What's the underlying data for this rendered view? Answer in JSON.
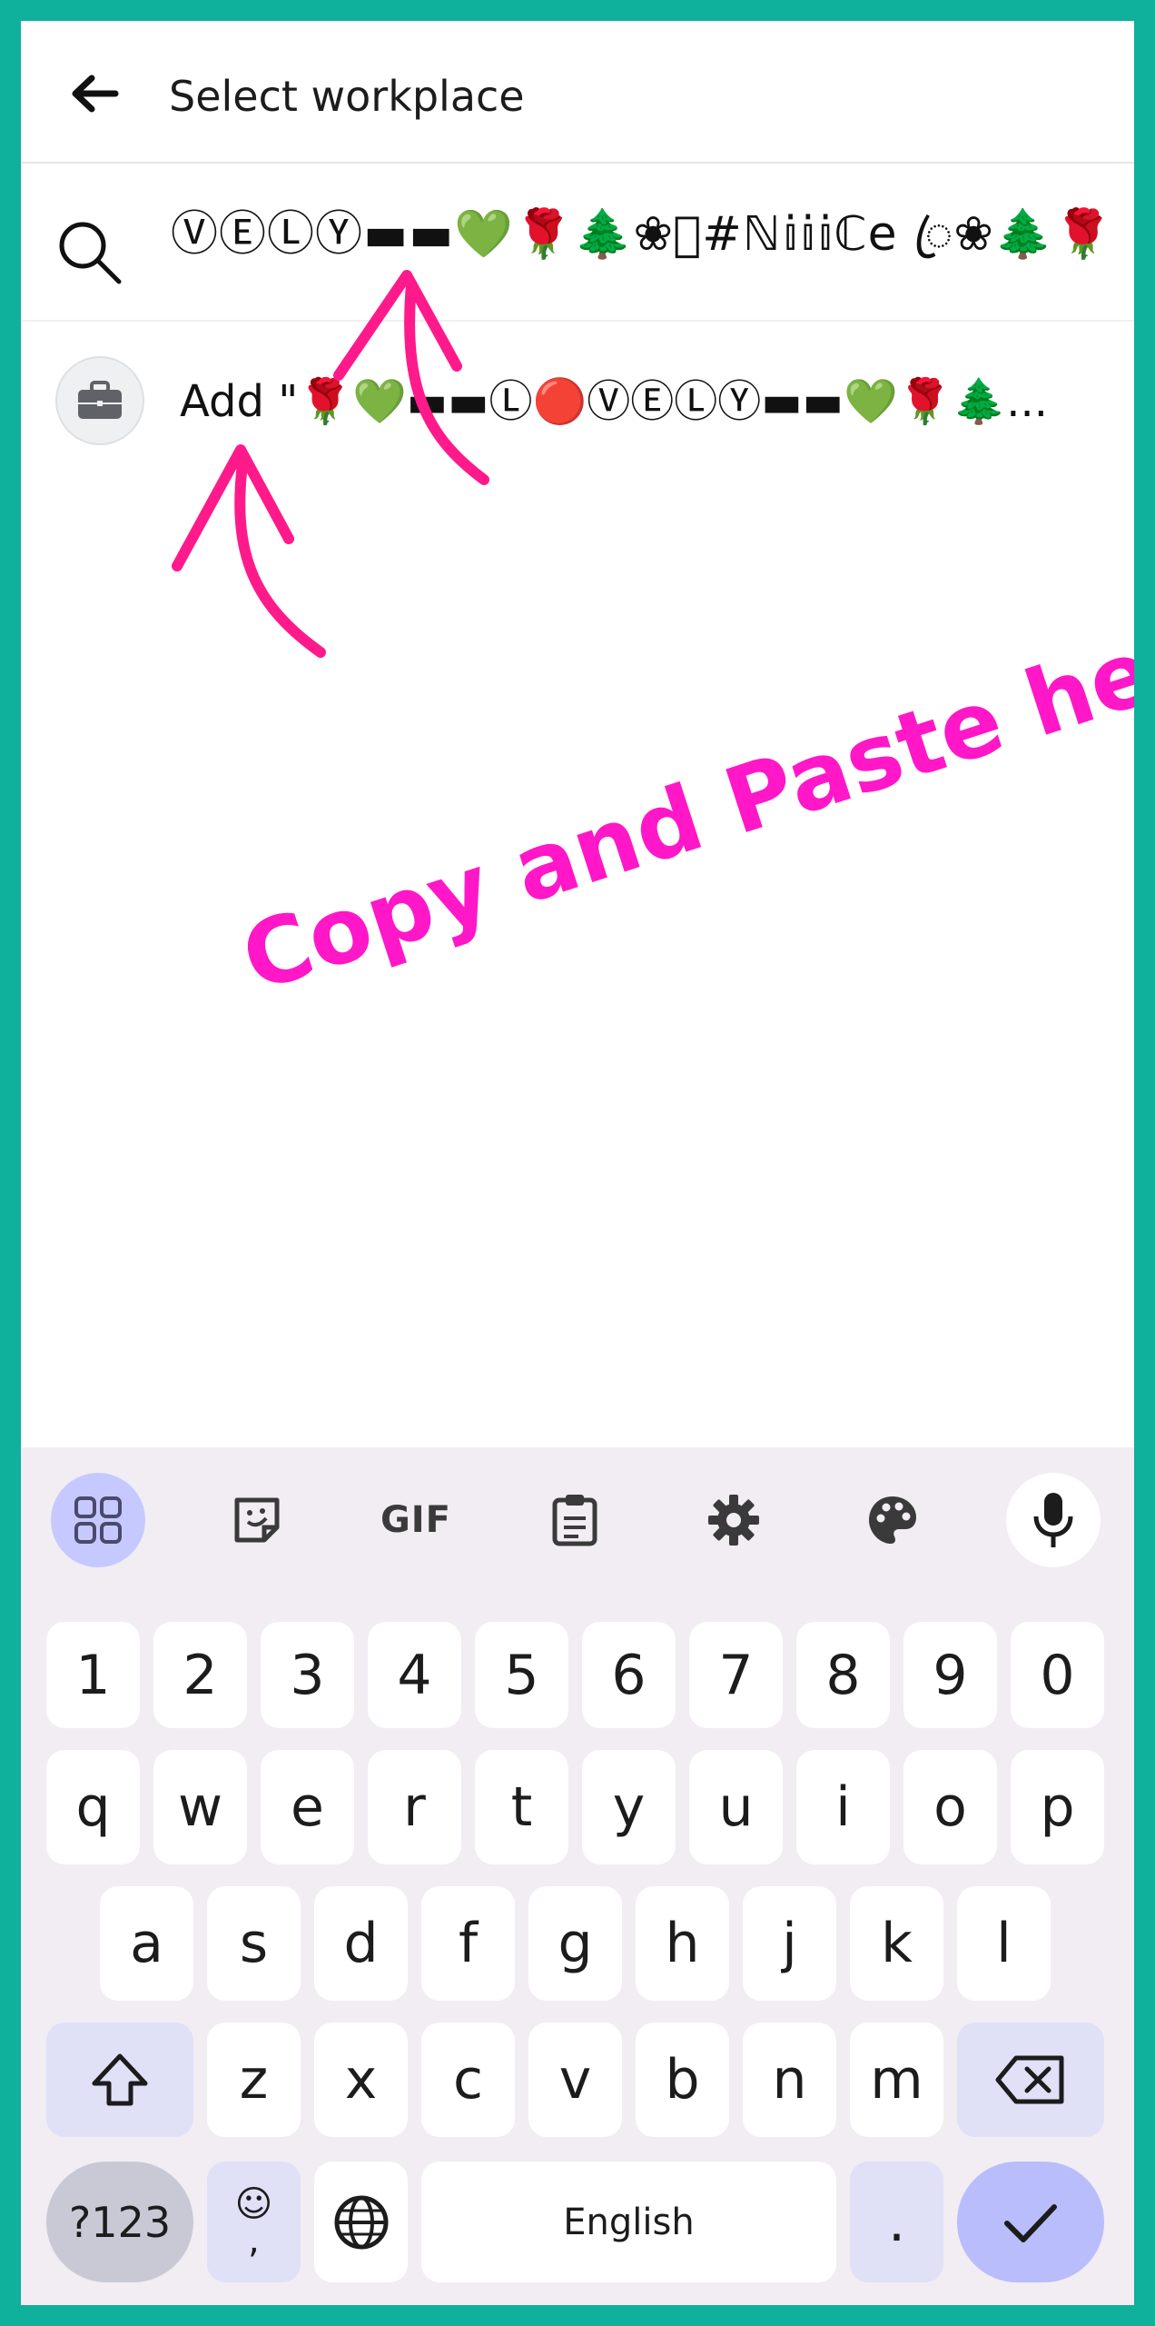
{
  "header": {
    "title": "Select workplace"
  },
  "search": {
    "query": "ⓋⒺⓁⓎ▬▬💚🌹🌲❀ꦿ#ℕ𝕚𝕚𝕚ℂe ꦿ❀🌲🌹"
  },
  "suggestion": {
    "label": "Add \"🌹💚▬▬Ⓛ🔴ⓋⒺⓁⓎ▬▬💚🌹🌲..."
  },
  "annotation": {
    "text": "Copy and Paste here",
    "color": "#ff17c8"
  },
  "keyboard": {
    "toolbar": {
      "apps": "apps-grid-icon",
      "sticker": "sticker-icon",
      "gif": "GIF",
      "clipboard": "clipboard-icon",
      "settings": "gear-icon",
      "theme": "palette-icon",
      "mic": "mic-icon"
    },
    "number_row": [
      "1",
      "2",
      "3",
      "4",
      "5",
      "6",
      "7",
      "8",
      "9",
      "0"
    ],
    "row1": [
      "q",
      "w",
      "e",
      "r",
      "t",
      "y",
      "u",
      "i",
      "o",
      "p"
    ],
    "row2": [
      "a",
      "s",
      "d",
      "f",
      "g",
      "h",
      "j",
      "k",
      "l"
    ],
    "row3": [
      "z",
      "x",
      "c",
      "v",
      "b",
      "n",
      "m"
    ],
    "symbols_label": "?123",
    "emoji_glyph": "☺",
    "comma_label": ",",
    "space_label": "English",
    "period_label": "."
  },
  "colors": {
    "frame": "#0fb09c",
    "accent": "#c6c9ff",
    "enter": "#b9bdfb"
  }
}
